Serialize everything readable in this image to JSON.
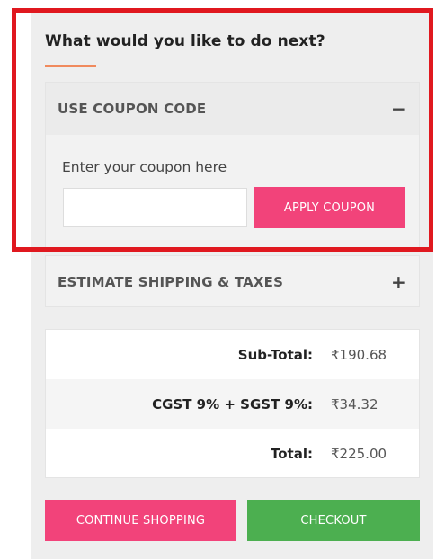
{
  "heading": "What would you like to do next?",
  "coupon": {
    "title": "USE COUPON CODE",
    "toggle_icon": "minus-icon",
    "label": "Enter your coupon here",
    "input_value": "",
    "input_placeholder": "",
    "apply_label": "APPLY COUPON"
  },
  "shipping": {
    "title": "ESTIMATE SHIPPING & TAXES",
    "toggle_icon": "plus-icon"
  },
  "totals": {
    "subtotal_label": "Sub-Total:",
    "subtotal_value": "₹190.68",
    "tax_label": "CGST 9% + SGST 9%:",
    "tax_value": "₹34.32",
    "total_label": "Total:",
    "total_value": "₹225.00"
  },
  "actions": {
    "continue_label": "CONTINUE SHOPPING",
    "checkout_label": "CHECKOUT"
  },
  "colors": {
    "accent_pink": "#f2437a",
    "checkout_green": "#4caf50",
    "highlight_red": "#e0181f",
    "heading_underline": "#f08a5d"
  }
}
